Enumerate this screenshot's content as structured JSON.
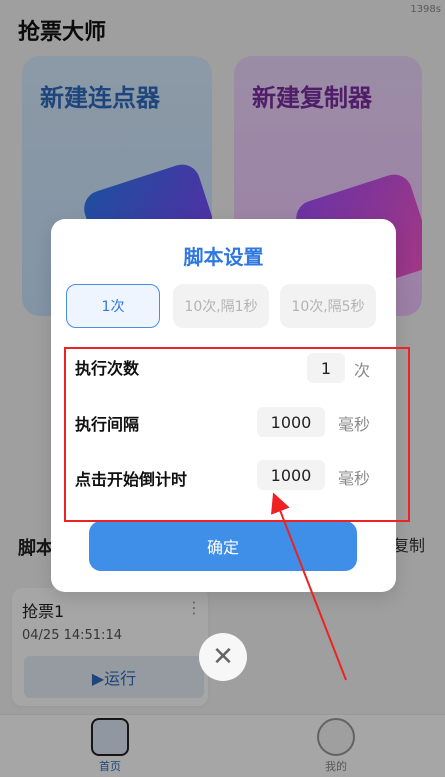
{
  "status": {
    "corner_text": "1398s"
  },
  "app": {
    "title": "抢票大师"
  },
  "cards": {
    "left": {
      "title": "新建连点器"
    },
    "right": {
      "title": "新建复制器"
    }
  },
  "section": {
    "label": "脚本",
    "copy_label": "复制"
  },
  "recent": {
    "name": "抢票1",
    "time": "04/25 14:51:14",
    "more": "⋮",
    "run_label": "▶运行"
  },
  "nav": {
    "home_label": "首页",
    "me_label": "我的"
  },
  "modal": {
    "title": "脚本设置",
    "presets": [
      "1次",
      "10次,隔1秒",
      "10次,隔5秒"
    ],
    "rows": [
      {
        "label": "执行次数",
        "value": "1",
        "unit": "次"
      },
      {
        "label": "执行间隔",
        "value": "1000",
        "unit": "毫秒"
      },
      {
        "label": "点击开始倒计时",
        "value": "1000",
        "unit": "毫秒"
      }
    ],
    "confirm_label": "确定"
  },
  "close": {
    "icon": "close-icon",
    "glyph": "✕"
  },
  "colors": {
    "accent": "#3f8ee8",
    "annotation": "#e22222"
  }
}
